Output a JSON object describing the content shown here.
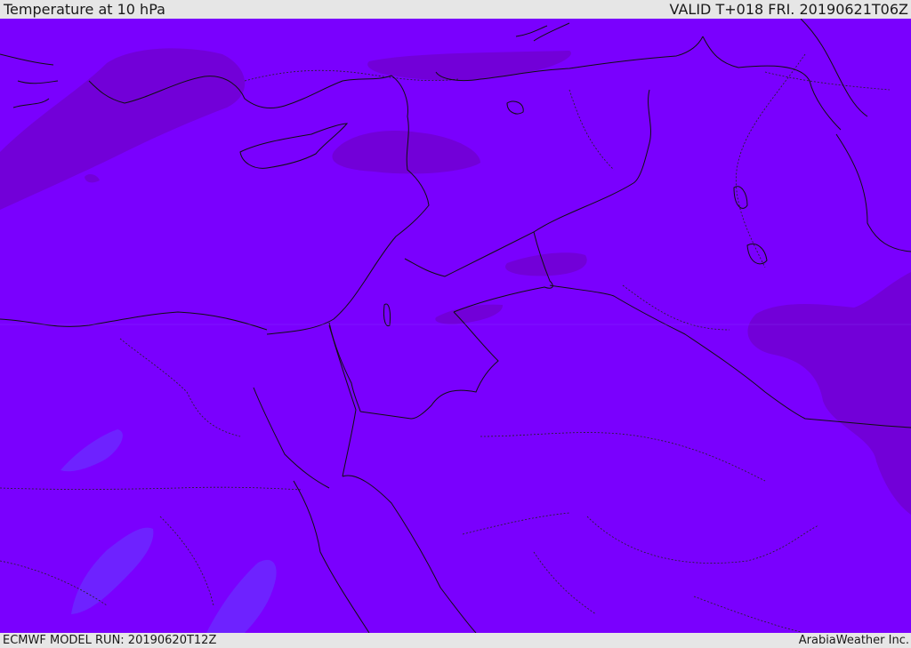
{
  "header": {
    "title": "Temperature at 10 hPa",
    "valid": "VALID T+018 FRI. 20190621T06Z"
  },
  "footer": {
    "model_run": "ECMWF MODEL RUN: 20190620T12Z",
    "credit": "ArabiaWeather Inc."
  },
  "colors": {
    "field_base": "#7a00fe",
    "field_warm": "#7200d8",
    "field_cool": "#6e22ff",
    "background": "#e6e6e6",
    "coastline": "#101010",
    "border": "#222222"
  }
}
